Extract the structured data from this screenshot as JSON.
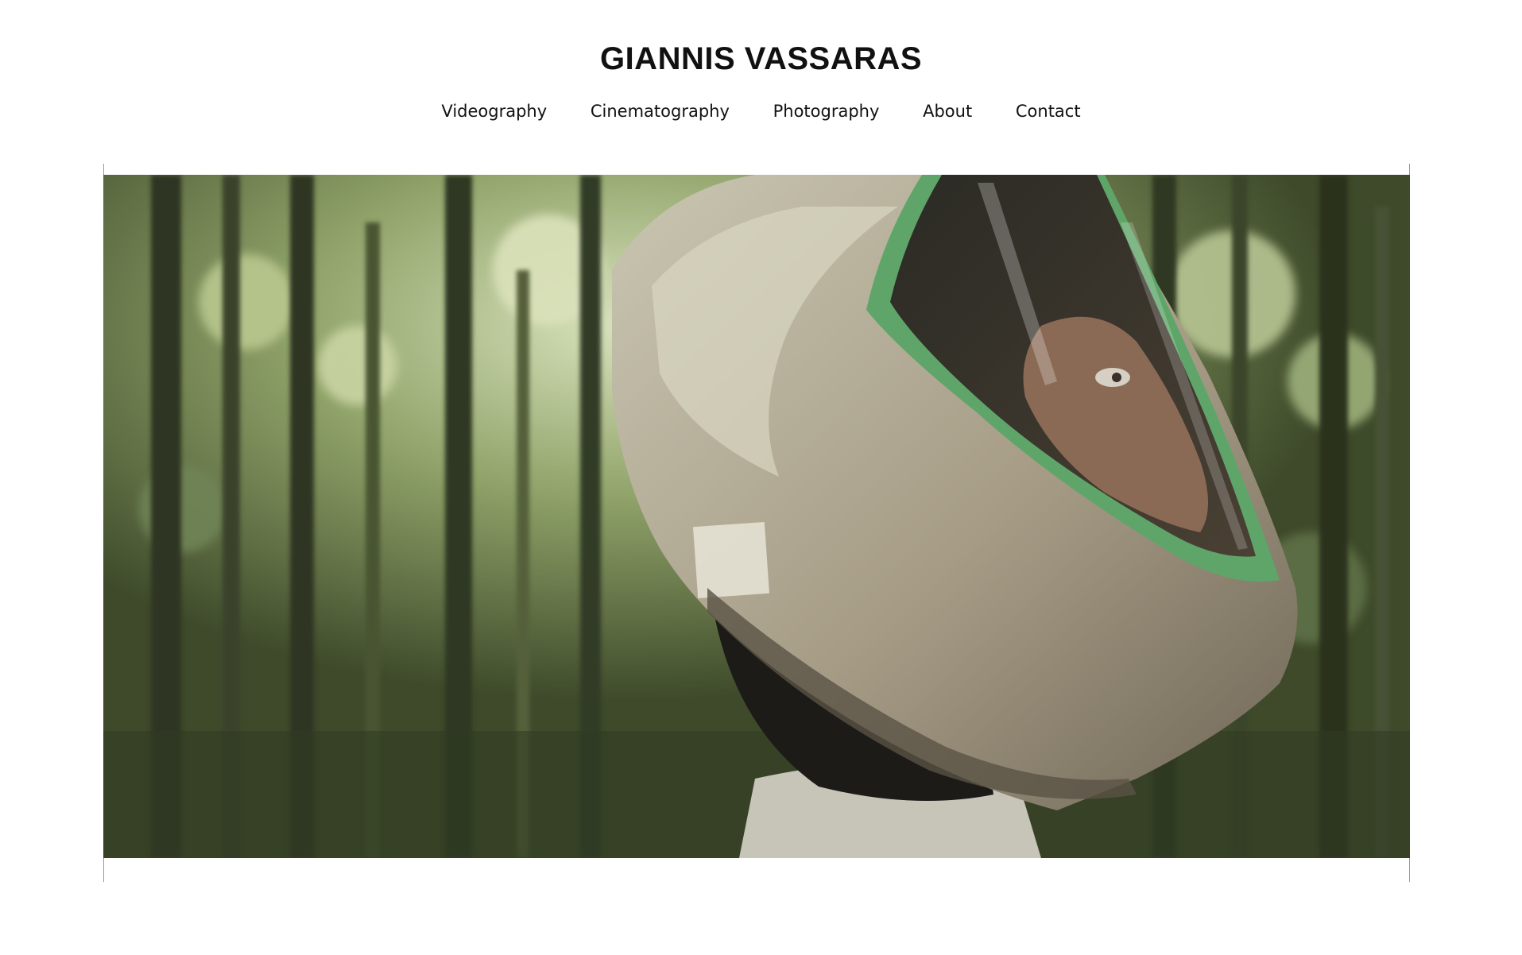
{
  "header": {
    "site_title": "GIANNIS VASSARAS"
  },
  "nav": {
    "items": [
      {
        "label": "Videography"
      },
      {
        "label": "Cinematography"
      },
      {
        "label": "Photography"
      },
      {
        "label": "About"
      },
      {
        "label": "Contact"
      }
    ]
  },
  "hero": {
    "image": "video-still-astronaut-in-forest"
  },
  "colors": {
    "text": "#111111",
    "background": "#ffffff",
    "frame_line": "#9a9a9a"
  }
}
